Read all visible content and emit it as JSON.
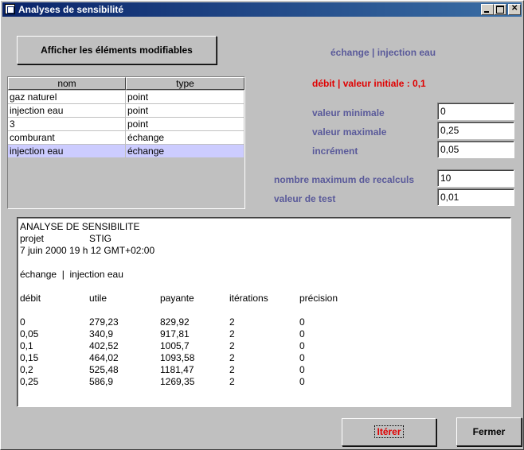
{
  "window": {
    "title": "Analyses de sensibilité"
  },
  "toolbar": {
    "afficher_label": "Afficher les éléments modifiables"
  },
  "header": {
    "selection": "échange  |  injection eau",
    "current": "débit  |  valeur initiale : 0,1"
  },
  "table": {
    "columns": [
      "nom",
      "type"
    ],
    "rows": [
      {
        "nom": "gaz naturel",
        "type": "point"
      },
      {
        "nom": "injection eau",
        "type": "point"
      },
      {
        "nom": "3",
        "type": "point"
      },
      {
        "nom": "comburant",
        "type": "échange"
      },
      {
        "nom": "injection eau",
        "type": "échange"
      }
    ],
    "selected_row": 4
  },
  "params": {
    "min_label": "valeur minimale",
    "min_value": "0",
    "max_label": "valeur maximale",
    "max_value": "0,25",
    "inc_label": "incrément",
    "inc_value": "0,05",
    "recalc_label": "nombre maximum de recalculs",
    "recalc_value": "10",
    "test_label": "valeur de test",
    "test_value": "0,01"
  },
  "report": {
    "title": "ANALYSE DE SENSIBILITE",
    "projet_label": "projet",
    "projet_value": "STIG",
    "date": "7 juin 2000 19 h 12 GMT+02:00",
    "selection": "échange  |  injection eau",
    "columns": [
      "débit",
      "utile",
      "payante",
      "itérations",
      "précision"
    ],
    "rows": [
      [
        "0",
        "279,23",
        "829,92",
        "2",
        "0"
      ],
      [
        "0,05",
        "340,9",
        "917,81",
        "2",
        "0"
      ],
      [
        "0,1",
        "402,52",
        "1005,7",
        "2",
        "0"
      ],
      [
        "0,15",
        "464,02",
        "1093,58",
        "2",
        "0"
      ],
      [
        "0,2",
        "525,48",
        "1181,47",
        "2",
        "0"
      ],
      [
        "0,25",
        "586,9",
        "1269,35",
        "2",
        "0"
      ]
    ]
  },
  "buttons": {
    "iterer": "Itérer",
    "fermer": "Fermer"
  },
  "colors": {
    "title_gradient_start": "#0a246a",
    "accent_red": "#e00000",
    "label_blue": "#5a5a9a",
    "selection": "#ccccff"
  }
}
